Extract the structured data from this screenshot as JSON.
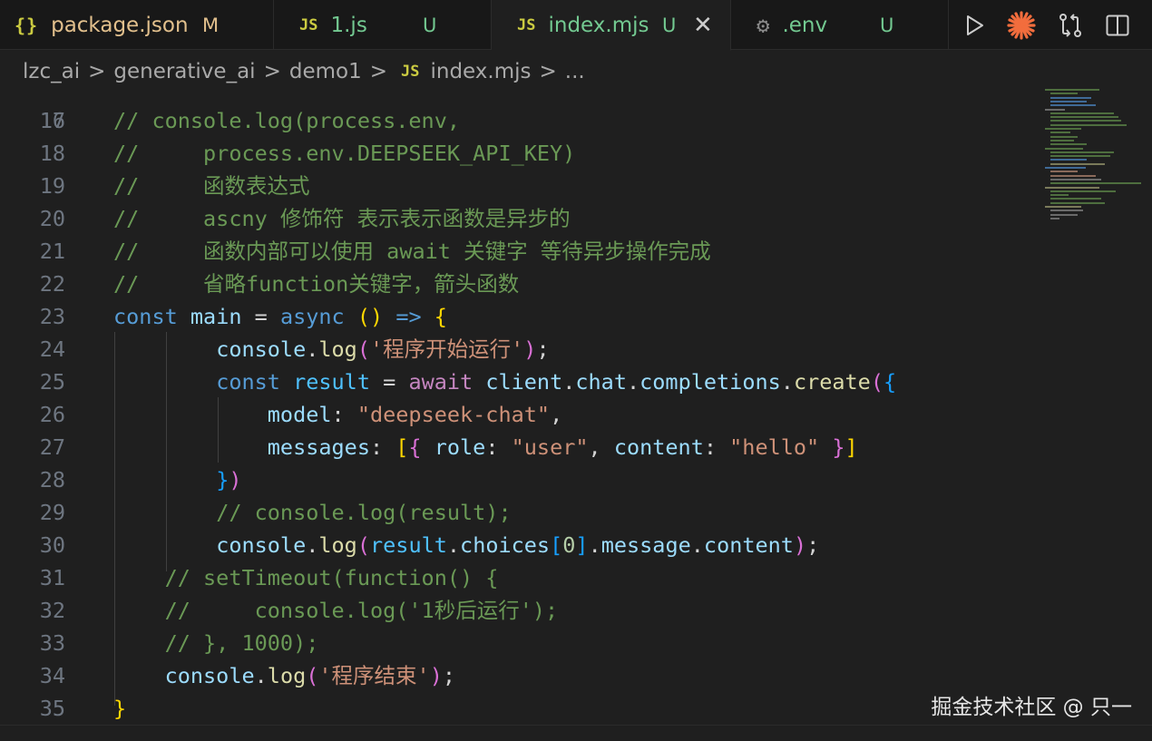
{
  "tabs": [
    {
      "icon": "{}",
      "label": "package.json",
      "status": "M"
    },
    {
      "icon": "JS",
      "label": "1.js",
      "status": "U"
    },
    {
      "icon": "JS",
      "label": "index.mjs",
      "status": "U",
      "active": true
    },
    {
      "icon": "gear",
      "label": ".env",
      "status": "U"
    }
  ],
  "breadcrumb": {
    "items": [
      "lzc_ai",
      "generative_ai",
      "demo1"
    ],
    "file_icon": "JS",
    "file": "index.mjs",
    "more": "...",
    "separator": ">"
  },
  "editor": {
    "partial_line_number": "16",
    "lines": [
      {
        "n": "17",
        "tokens": [
          [
            "com",
            "// console.log(process.env,"
          ]
        ]
      },
      {
        "n": "18",
        "tokens": [
          [
            "com",
            "//     process.env.DEEPSEEK_API_KEY)"
          ]
        ]
      },
      {
        "n": "19",
        "tokens": [
          [
            "com",
            "//     函数表达式"
          ]
        ]
      },
      {
        "n": "20",
        "tokens": [
          [
            "com",
            "//     ascny 修饰符 表示表示函数是异步的"
          ]
        ]
      },
      {
        "n": "21",
        "tokens": [
          [
            "com",
            "//     函数内部可以使用 await 关键字 等待异步操作完成"
          ]
        ]
      },
      {
        "n": "22",
        "tokens": [
          [
            "com",
            "//     省略function关键字，箭头函数"
          ]
        ]
      },
      {
        "n": "23",
        "tokens": [
          [
            "kw",
            "const"
          ],
          [
            "op",
            " "
          ],
          [
            "var",
            "main"
          ],
          [
            "op",
            " = "
          ],
          [
            "kw",
            "async"
          ],
          [
            "op",
            " "
          ],
          [
            "p1",
            "()"
          ],
          [
            "op",
            " "
          ],
          [
            "kw",
            "=>"
          ],
          [
            "op",
            " "
          ],
          [
            "p1",
            "{"
          ]
        ]
      },
      {
        "n": "24",
        "tokens": [
          [
            "op",
            "        "
          ],
          [
            "var",
            "console"
          ],
          [
            "op",
            "."
          ],
          [
            "fn",
            "log"
          ],
          [
            "p2",
            "("
          ],
          [
            "str",
            "'程序开始运行'"
          ],
          [
            "p2",
            ")"
          ],
          [
            "op",
            ";"
          ]
        ]
      },
      {
        "n": "25",
        "tokens": [
          [
            "op",
            "        "
          ],
          [
            "kw",
            "const"
          ],
          [
            "op",
            " "
          ],
          [
            "const",
            "result"
          ],
          [
            "op",
            " = "
          ],
          [
            "ctrl",
            "await"
          ],
          [
            "op",
            " "
          ],
          [
            "var",
            "client"
          ],
          [
            "op",
            "."
          ],
          [
            "var",
            "chat"
          ],
          [
            "op",
            "."
          ],
          [
            "var",
            "completions"
          ],
          [
            "op",
            "."
          ],
          [
            "fn",
            "create"
          ],
          [
            "p2",
            "("
          ],
          [
            "p3",
            "{"
          ]
        ]
      },
      {
        "n": "26",
        "tokens": [
          [
            "op",
            "            "
          ],
          [
            "var",
            "model"
          ],
          [
            "op",
            ": "
          ],
          [
            "str",
            "\"deepseek-chat\""
          ],
          [
            "op",
            ","
          ]
        ]
      },
      {
        "n": "27",
        "tokens": [
          [
            "op",
            "            "
          ],
          [
            "var",
            "messages"
          ],
          [
            "op",
            ": "
          ],
          [
            "p1",
            "["
          ],
          [
            "p2",
            "{"
          ],
          [
            "op",
            " "
          ],
          [
            "var",
            "role"
          ],
          [
            "op",
            ": "
          ],
          [
            "str",
            "\"user\""
          ],
          [
            "op",
            ", "
          ],
          [
            "var",
            "content"
          ],
          [
            "op",
            ": "
          ],
          [
            "str",
            "\"hello\""
          ],
          [
            "op",
            " "
          ],
          [
            "p2",
            "}"
          ],
          [
            "p1",
            "]"
          ]
        ]
      },
      {
        "n": "28",
        "tokens": [
          [
            "op",
            "        "
          ],
          [
            "p3",
            "}"
          ],
          [
            "p2",
            ")"
          ]
        ]
      },
      {
        "n": "29",
        "tokens": [
          [
            "op",
            "        "
          ],
          [
            "com",
            "// console.log(result);"
          ]
        ]
      },
      {
        "n": "30",
        "tokens": [
          [
            "op",
            "        "
          ],
          [
            "var",
            "console"
          ],
          [
            "op",
            "."
          ],
          [
            "fn",
            "log"
          ],
          [
            "p2",
            "("
          ],
          [
            "const",
            "result"
          ],
          [
            "op",
            "."
          ],
          [
            "var",
            "choices"
          ],
          [
            "p3",
            "["
          ],
          [
            "num",
            "0"
          ],
          [
            "p3",
            "]"
          ],
          [
            "op",
            "."
          ],
          [
            "var",
            "message"
          ],
          [
            "op",
            "."
          ],
          [
            "var",
            "content"
          ],
          [
            "p2",
            ")"
          ],
          [
            "op",
            ";"
          ]
        ]
      },
      {
        "n": "31",
        "tokens": [
          [
            "op",
            "    "
          ],
          [
            "com",
            "// setTimeout(function() {"
          ]
        ]
      },
      {
        "n": "32",
        "tokens": [
          [
            "op",
            "    "
          ],
          [
            "com",
            "//     console.log('1秒后运行');"
          ]
        ]
      },
      {
        "n": "33",
        "tokens": [
          [
            "op",
            "    "
          ],
          [
            "com",
            "// }, 1000);"
          ]
        ]
      },
      {
        "n": "34",
        "tokens": [
          [
            "op",
            "    "
          ],
          [
            "var",
            "console"
          ],
          [
            "op",
            "."
          ],
          [
            "fn",
            "log"
          ],
          [
            "p2",
            "("
          ],
          [
            "str",
            "'程序结束'"
          ],
          [
            "p2",
            ")"
          ],
          [
            "op",
            ";"
          ]
        ]
      },
      {
        "n": "35",
        "tokens": [
          [
            "p1",
            "}"
          ]
        ]
      }
    ]
  },
  "watermark": "掘金技术社区 @ 只一",
  "colors": {
    "background": "#1f1f1f",
    "comment": "#6a9955",
    "keyword": "#569cd6",
    "string": "#ce9178",
    "untracked": "#73c991",
    "modified": "#e2c08d"
  }
}
